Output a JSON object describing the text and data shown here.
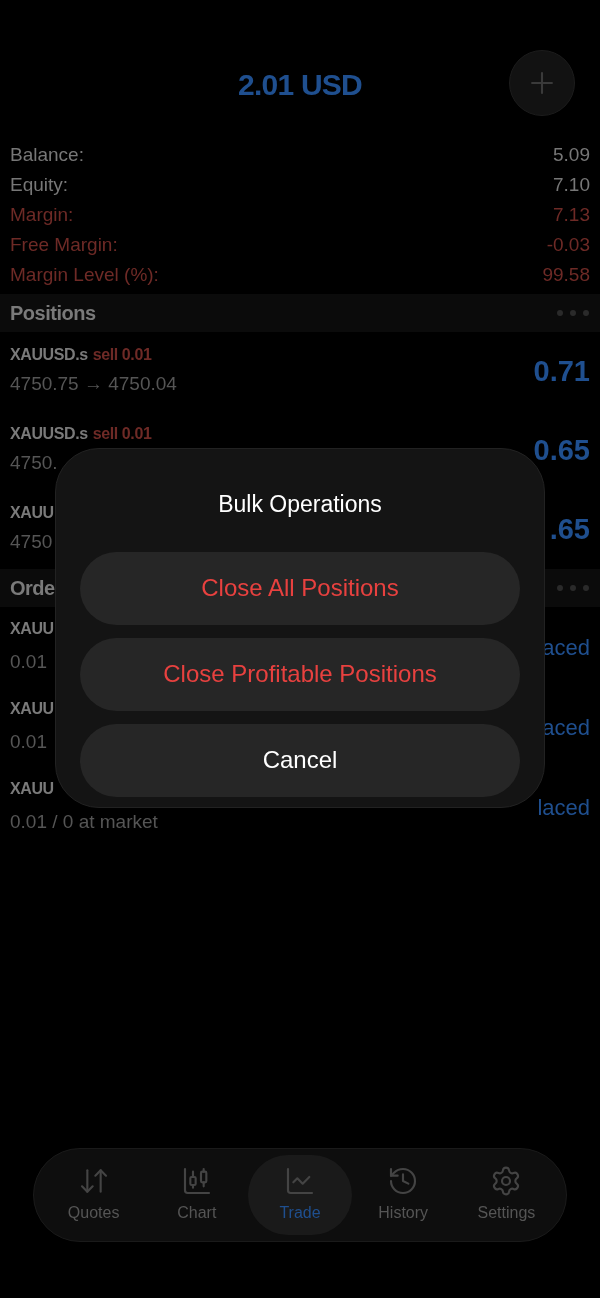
{
  "header": {
    "total": "2.01 USD"
  },
  "summary": [
    {
      "label": "Balance:",
      "value": "5.09",
      "kind": "normal"
    },
    {
      "label": "Equity:",
      "value": "7.10",
      "kind": "normal"
    },
    {
      "label": "Margin:",
      "value": "7.13",
      "kind": "warning"
    },
    {
      "label": "Free Margin:",
      "value": "-0.03",
      "kind": "warning"
    },
    {
      "label": "Margin Level (%):",
      "value": "99.58",
      "kind": "warning"
    }
  ],
  "positions": {
    "title": "Positions",
    "rows": [
      {
        "symbol": "XAUUSD.s",
        "side": "sell 0.01",
        "prices": "4750.75 → 4750.04",
        "profit": "0.71"
      },
      {
        "symbol": "XAUUSD.s",
        "side": "sell 0.01",
        "prices": "4750.",
        "profit": "0.65"
      },
      {
        "symbol": "XAUU",
        "prices": "4750",
        "profit": ".65"
      }
    ]
  },
  "orders": {
    "title": "Orde",
    "rows": [
      {
        "symbol": "XAUU",
        "detail": "0.01",
        "status": "aced"
      },
      {
        "symbol": "XAUU",
        "detail": "0.01",
        "status": "aced"
      },
      {
        "symbol": "XAUU",
        "detail": "0.01 / 0 at market",
        "status": "laced"
      }
    ]
  },
  "dialog": {
    "title": "Bulk Operations",
    "buttons": [
      {
        "label": "Close All Positions",
        "kind": "destructive"
      },
      {
        "label": "Close Profitable Positions",
        "kind": "destructive"
      },
      {
        "label": "Cancel",
        "kind": "cancel"
      }
    ]
  },
  "tabs": [
    {
      "label": "Quotes",
      "selected": false
    },
    {
      "label": "Chart",
      "selected": false
    },
    {
      "label": "Trade",
      "selected": true
    },
    {
      "label": "History",
      "selected": false
    },
    {
      "label": "Settings",
      "selected": false
    }
  ]
}
